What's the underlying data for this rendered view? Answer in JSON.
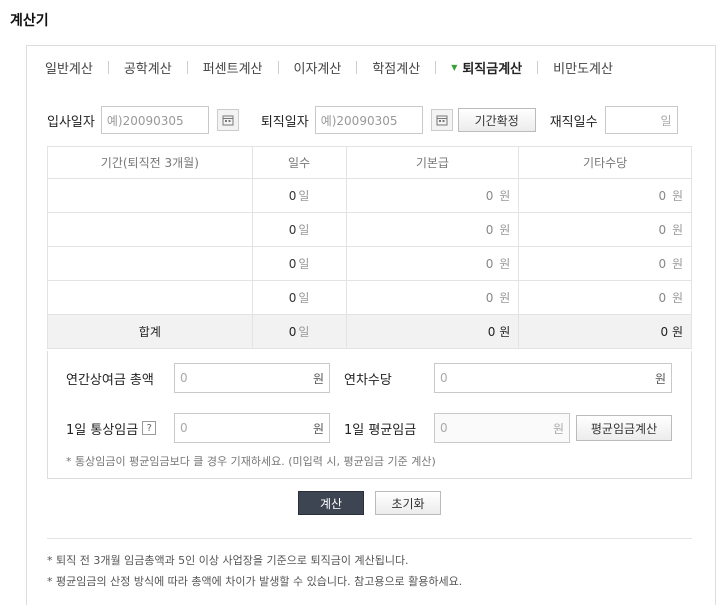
{
  "page_title": "계산기",
  "tabs": [
    {
      "label": "일반계산",
      "active": false
    },
    {
      "label": "공학계산",
      "active": false
    },
    {
      "label": "퍼센트계산",
      "active": false
    },
    {
      "label": "이자계산",
      "active": false
    },
    {
      "label": "학점계산",
      "active": false
    },
    {
      "label": "퇴직금계산",
      "active": true
    },
    {
      "label": "비만도계산",
      "active": false
    }
  ],
  "dates": {
    "join_label": "입사일자",
    "join_placeholder": "예)20090305",
    "leave_label": "퇴직일자",
    "leave_placeholder": "예)20090305",
    "confirm_button": "기간확정",
    "tenure_label": "재직일수",
    "tenure_unit": "일"
  },
  "table": {
    "headers": [
      "기간(퇴직전 3개월)",
      "일수",
      "기본급",
      "기타수당"
    ],
    "rows": [
      {
        "period": "",
        "days": "0",
        "base": "0",
        "other": "0"
      },
      {
        "period": "",
        "days": "0",
        "base": "0",
        "other": "0"
      },
      {
        "period": "",
        "days": "0",
        "base": "0",
        "other": "0"
      },
      {
        "period": "",
        "days": "0",
        "base": "0",
        "other": "0"
      }
    ],
    "total": {
      "label": "합계",
      "days": "0",
      "base": "0",
      "other": "0"
    },
    "day_unit": "일",
    "won_unit": "원"
  },
  "extra": {
    "bonus_label": "연간상여금 총액",
    "bonus_value": "0",
    "leave_allow_label": "연차수당",
    "leave_allow_value": "0",
    "ordinary_label": "1일 통상임금",
    "ordinary_help": "?",
    "ordinary_value": "0",
    "avg_label": "1일 평균임금",
    "avg_value": "0",
    "avg_button": "평균임금계산",
    "won": "원",
    "note": "* 통상임금이 평균임금보다 클 경우 기재하세요. (미입력 시, 평균임금 기준 계산)"
  },
  "actions": {
    "calc": "계산",
    "reset": "초기화"
  },
  "footnotes": [
    "* 퇴직 전 3개월 임금총액과 5인 이상 사업장을 기준으로 퇴직금이 계산됩니다.",
    "* 평균임금의 산정 방식에 따라 총액에 차이가 발생할 수 있습니다. 참고용으로 활용하세요."
  ]
}
